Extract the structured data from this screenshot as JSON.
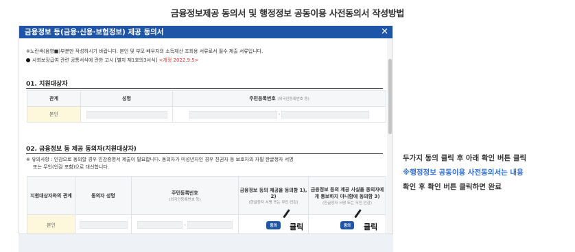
{
  "page_title": "금융정보제공 동의서 및 행정정보 공동이용 사전동의서 작성방법",
  "modal": {
    "title": "금융정보 등(금융·신용·보험정보) 제공 동의서",
    "close_icon": "close-icon"
  },
  "notes": {
    "line1": "※노란색(음영■)부분만 작성하시기 바랍니다. 본인 및 부모·배우자의 소득재산 조회용 서류로서 필수 제출 서류입니다.",
    "line2_text": "사회보장급여 관련 공통서식에 관한 고시 [별지 제1호의3서식]",
    "line2_red": "<개정 2022.9.5>"
  },
  "section1": {
    "title": "01. 지원대상자",
    "headers": [
      "관계",
      "성명",
      "주민등록번호"
    ],
    "rrn_sub": "(외국인등록번호 등)",
    "row_label": "본인",
    "rrn_dash": "-"
  },
  "section2": {
    "title": "02. 금융정보 등 제공 동의자(지원대상자)",
    "caution_line1": "※ 유의사항 : 인감으로 동의할 경우 인감증명서 제출이 필요합니다. 동의자가 미성년자인 경우 친권자 등 보호자의 자필 한글정자 서명",
    "caution_line2": "또는 무인(인감 포함)으로 대신합니다.",
    "headers": {
      "relation": "지원대상자와의 관계",
      "name": "동의자 성명",
      "rrn": "주민등록번호",
      "rrn_sub": "(외국인등록번호 등)",
      "consent1": "금융정보 등의 제공을 동의함 1), 2)",
      "consent1_sub": "(한글정자 서명 또는 무인·인감)",
      "consent2": "금융정보 등의 제공 사실을 동의자에게 통보하지 아니함에 동의함 3)",
      "consent2_sub": "(한글정자 서명 또는 무인·인감)"
    },
    "row_label": "본인",
    "rrn_dash": "-",
    "consent_button": "동의",
    "click_label": "클릭"
  },
  "side_text": {
    "line1": "두가지 동의 클릭 후 아래 확인 버튼 클릭",
    "line2": "※행정정보 공동이용 사전동의서는 내용",
    "line3": "확인 후 확인 버튼 클릭하면 완료"
  },
  "colors": {
    "header_blue": "#1f55a6",
    "highlight_yellow": "#fdf7dc",
    "accent_blue": "#2f6fd6",
    "note_red": "#d0342c"
  }
}
